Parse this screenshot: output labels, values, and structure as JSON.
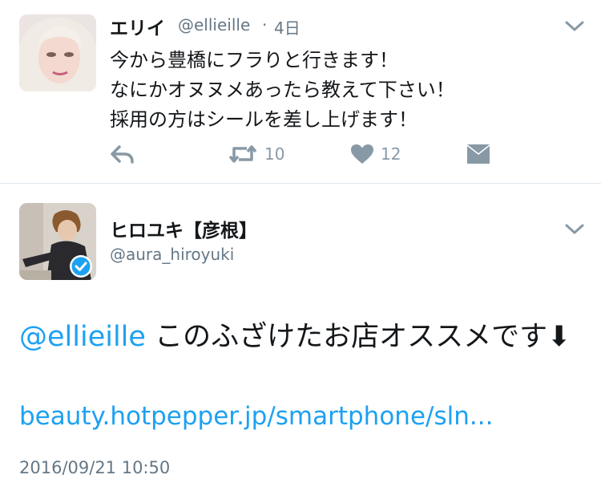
{
  "tweet1": {
    "display_name": "エリイ",
    "handle": "@ellieille",
    "separator": "·",
    "time": "4日",
    "lines": [
      "今から豊橋にフラりと行きます！",
      "なにかオヌヌメあったら教えて下さい！",
      "採用の方はシールを差し上げます！"
    ],
    "actions": {
      "reply_icon": "reply-icon",
      "retweet_icon": "retweet-icon",
      "retweet_count": "10",
      "like_icon": "heart-icon",
      "like_count": "12",
      "dm_icon": "envelope-icon"
    }
  },
  "tweet2": {
    "display_name": "ヒロユキ【彦根】",
    "handle": "@aura_hiroyuki",
    "verified_icon": "verified-badge-icon",
    "mention": "@ellieille",
    "text": " このふざけたお店オススメです",
    "arrow": "⬇",
    "link": "beauty.hotpepper.jp/smartphone/sln...",
    "timestamp": "2016/09/21 10:50"
  },
  "colors": {
    "link": "#1da1f2",
    "muted": "#657786",
    "icon": "#8899a6",
    "divider": "#e1e8ed",
    "verified": "#1da1f2"
  }
}
